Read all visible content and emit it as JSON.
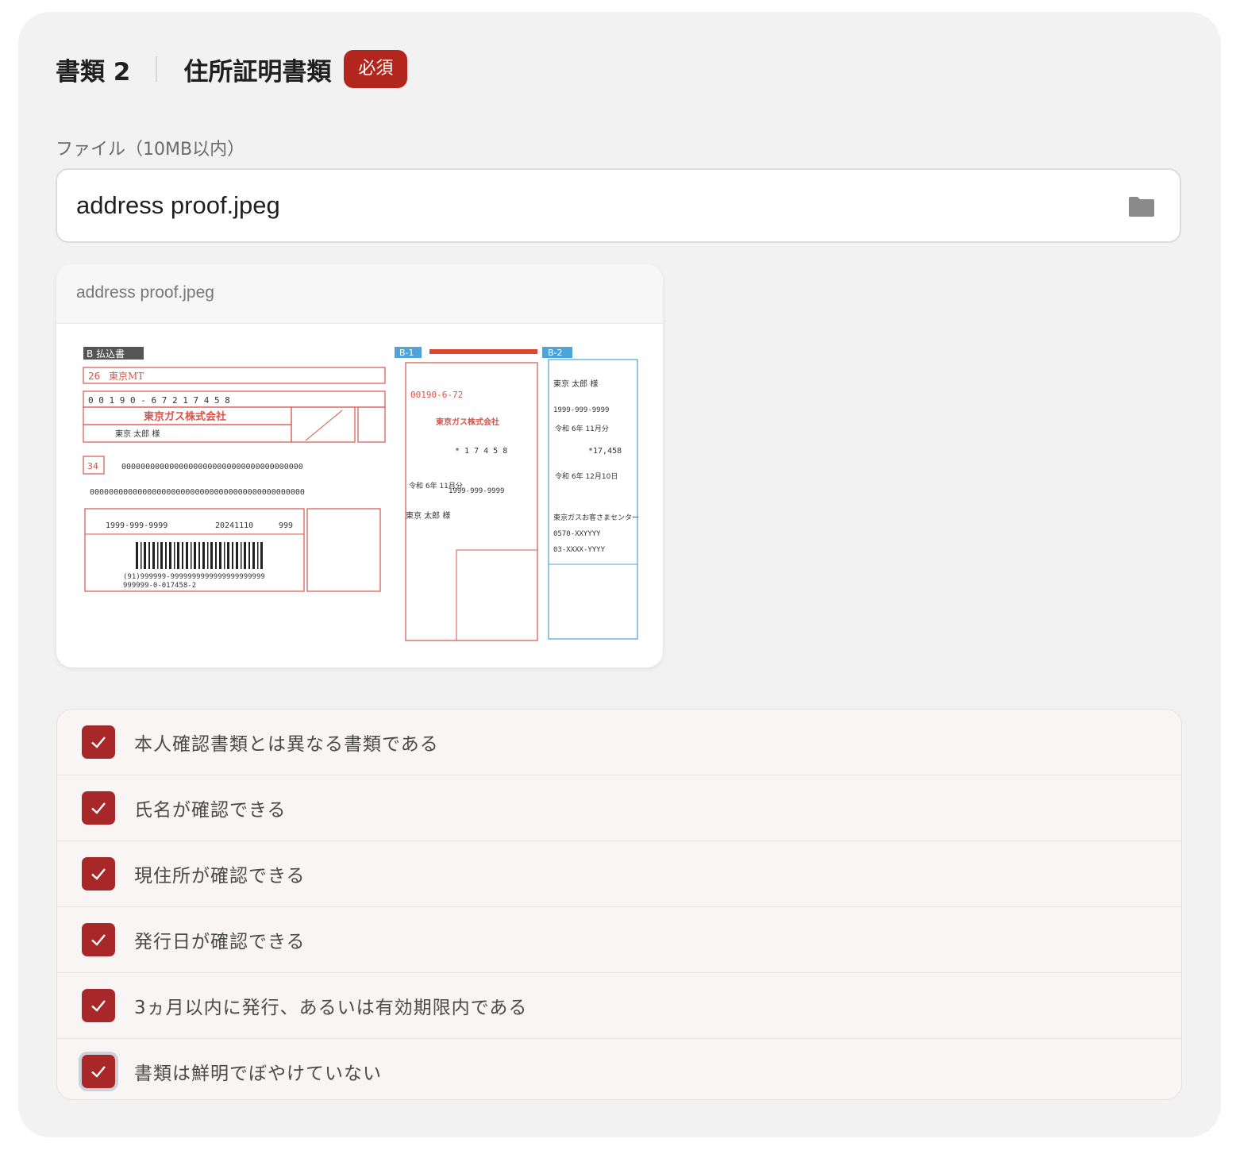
{
  "header": {
    "doc_number": "書類 2",
    "doc_title": "住所証明書類",
    "required_badge": "必須"
  },
  "file": {
    "label": "ファイル（10MB以内）",
    "value": "address proof.jpeg",
    "icon": "folder-icon"
  },
  "preview": {
    "filename": "address proof.jpeg",
    "image": {
      "bill_header": "B 払込書",
      "b1": "B-1",
      "b2": "B-2",
      "code": "26",
      "company_short": "東京MT",
      "company": "東京ガス株式会社",
      "name": "東京 太郎 様",
      "amount": "*17,458",
      "phone": "1999-999-9999",
      "date": "20241110",
      "barcode_text": "(91)999999-9999999999999999999999",
      "barcode_text2": "999999-0-017458-2",
      "account": "00190-6-72",
      "era": "令和 6年 11月分",
      "due": "令和 6年 12月10日",
      "contact": "東京ガスお客さまセンター",
      "contact_tel": "0570-XXYYYY",
      "contact_tel2": "03-XXXX-YYYY"
    }
  },
  "checklist": [
    {
      "label": "本人確認書類とは異なる書類である",
      "checked": true
    },
    {
      "label": "氏名が確認できる",
      "checked": true
    },
    {
      "label": "現住所が確認できる",
      "checked": true
    },
    {
      "label": "発行日が確認できる",
      "checked": true
    },
    {
      "label": "3ヵ月以内に発行、あるいは有効期限内である",
      "checked": true
    },
    {
      "label": "書類は鮮明でぼやけていない",
      "checked": true
    }
  ],
  "colors": {
    "accent": "#a8282a",
    "badge": "#b3261e",
    "bill_red": "#d9534a",
    "bill_blue": "#4ea3d8"
  }
}
